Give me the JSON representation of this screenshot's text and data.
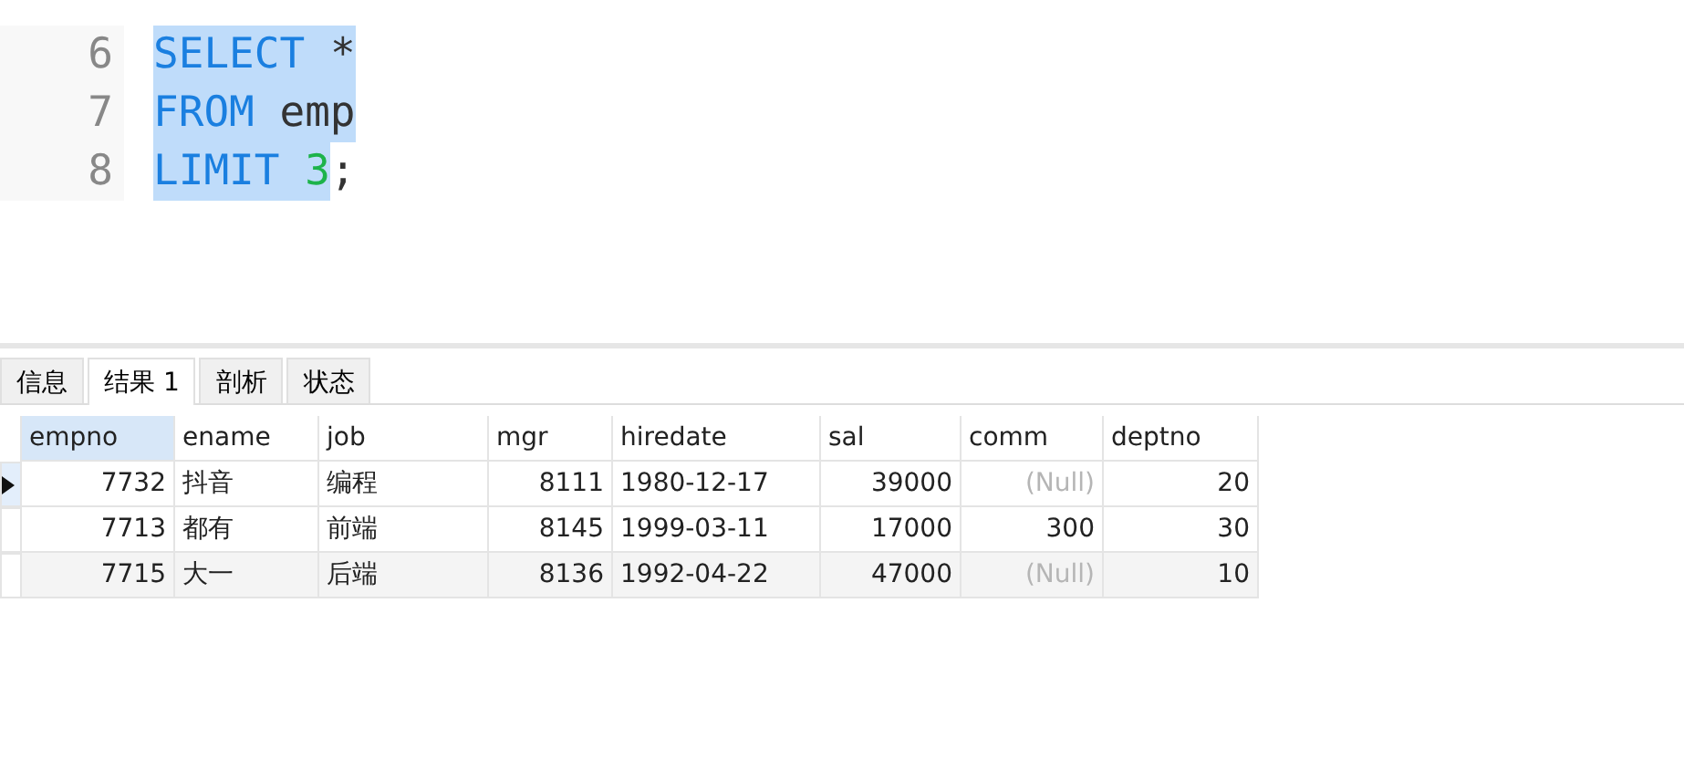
{
  "editor": {
    "lines": [
      {
        "number": "6",
        "tokens": [
          {
            "text": "SELECT",
            "kind": "keyword",
            "selected": true
          },
          {
            "text": " *",
            "kind": "ident",
            "selected": true
          }
        ]
      },
      {
        "number": "7",
        "tokens": [
          {
            "text": "FROM",
            "kind": "keyword",
            "selected": true
          },
          {
            "text": " emp",
            "kind": "ident",
            "selected": true
          }
        ]
      },
      {
        "number": "8",
        "tokens": [
          {
            "text": "LIMIT",
            "kind": "keyword",
            "selected": true
          },
          {
            "text": " 3",
            "kind": "number",
            "selected": true
          },
          {
            "text": ";",
            "kind": "ident",
            "selected": false
          }
        ]
      }
    ]
  },
  "tabs": [
    {
      "label": "信息",
      "selected": false
    },
    {
      "label": "结果 1",
      "selected": true
    },
    {
      "label": "剖析",
      "selected": false
    },
    {
      "label": "状态",
      "selected": false
    }
  ],
  "table": {
    "columns": [
      {
        "name": "empno",
        "kind": "numeric",
        "selected": true
      },
      {
        "name": "ename",
        "kind": "text",
        "selected": false
      },
      {
        "name": "job",
        "kind": "text",
        "selected": false
      },
      {
        "name": "mgr",
        "kind": "numeric",
        "selected": false
      },
      {
        "name": "hiredate",
        "kind": "text",
        "selected": false
      },
      {
        "name": "sal",
        "kind": "numeric",
        "selected": false
      },
      {
        "name": "comm",
        "kind": "numeric",
        "selected": false
      },
      {
        "name": "deptno",
        "kind": "numeric",
        "selected": false
      }
    ],
    "rows": [
      {
        "selected": true,
        "cells": [
          {
            "text": "7732",
            "kind": "value"
          },
          {
            "text": "抖音",
            "kind": "value"
          },
          {
            "text": "编程",
            "kind": "value"
          },
          {
            "text": "8111",
            "kind": "value"
          },
          {
            "text": "1980-12-17",
            "kind": "value"
          },
          {
            "text": "39000",
            "kind": "value"
          },
          {
            "text": "(Null)",
            "kind": "null"
          },
          {
            "text": "20",
            "kind": "value"
          }
        ]
      },
      {
        "selected": false,
        "cells": [
          {
            "text": "7713",
            "kind": "value"
          },
          {
            "text": "都有",
            "kind": "value"
          },
          {
            "text": "前端",
            "kind": "value"
          },
          {
            "text": "8145",
            "kind": "value"
          },
          {
            "text": "1999-03-11",
            "kind": "value"
          },
          {
            "text": "17000",
            "kind": "value"
          },
          {
            "text": "300",
            "kind": "value"
          },
          {
            "text": "30",
            "kind": "value"
          }
        ]
      },
      {
        "selected": false,
        "cells": [
          {
            "text": "7715",
            "kind": "value"
          },
          {
            "text": "大一",
            "kind": "value"
          },
          {
            "text": "后端",
            "kind": "value"
          },
          {
            "text": "8136",
            "kind": "value"
          },
          {
            "text": "1992-04-22",
            "kind": "value"
          },
          {
            "text": "47000",
            "kind": "value"
          },
          {
            "text": "(Null)",
            "kind": "null"
          },
          {
            "text": "10",
            "kind": "value"
          }
        ]
      }
    ]
  }
}
